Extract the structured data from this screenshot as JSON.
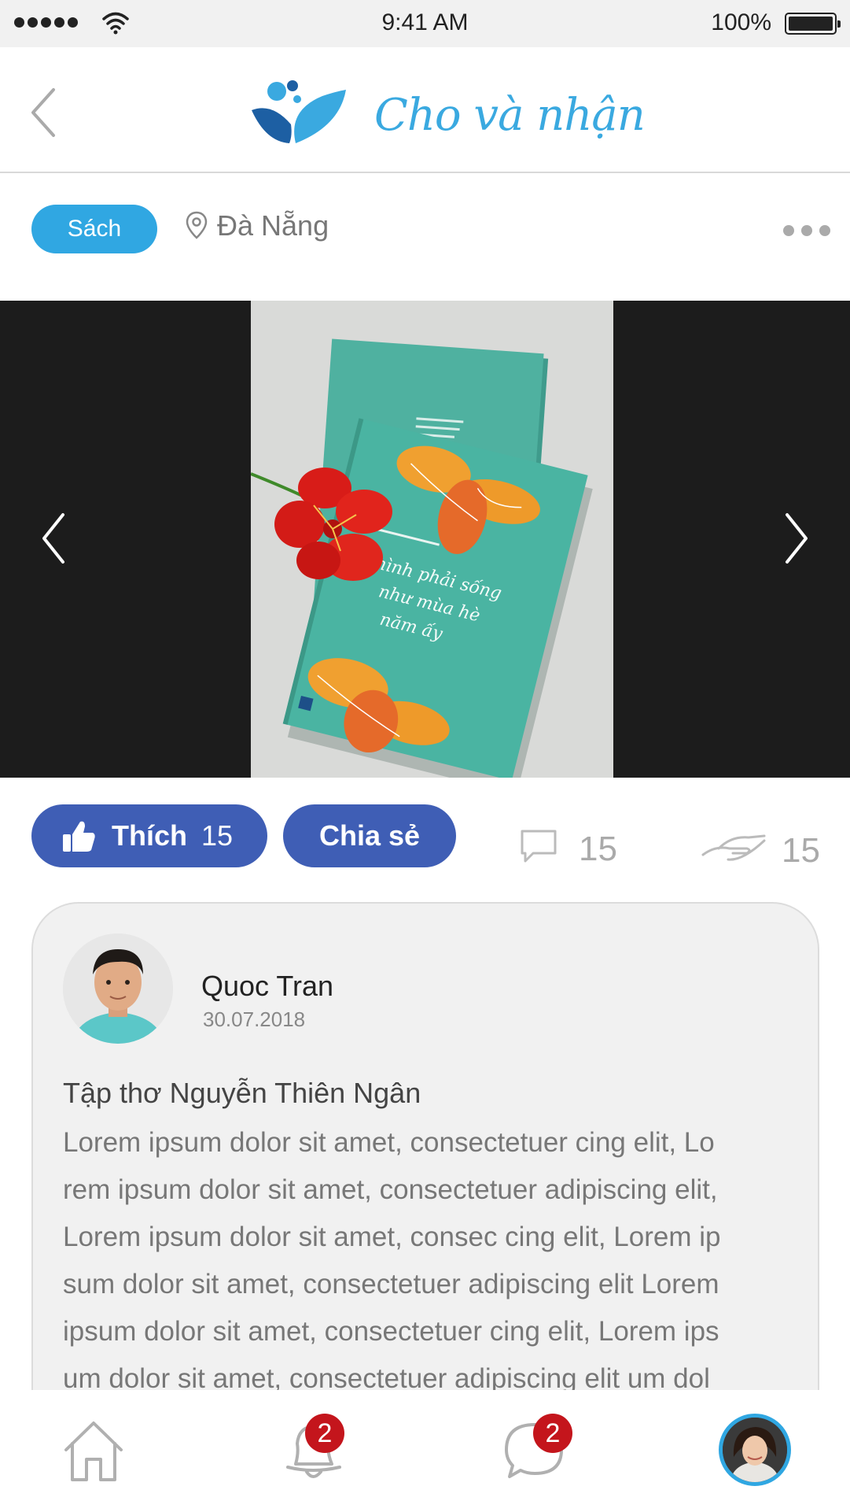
{
  "status_bar": {
    "time": "9:41 AM",
    "battery": "100%"
  },
  "header": {
    "title": "Cho và nhận"
  },
  "post_meta": {
    "category": "Sách",
    "location": "Đà Nẵng"
  },
  "actions": {
    "like_label": "Thích",
    "like_count": "15",
    "share_label": "Chia sẻ",
    "comment_count": "15",
    "give_count": "15"
  },
  "post": {
    "author": "Quoc Tran",
    "date": "30.07.2018",
    "title": "Tập thơ Nguyễn Thiên Ngân",
    "body_lines": [
      "Lorem ipsum dolor sit amet, consectetuer  cing elit, Lo",
      "rem ipsum dolor sit amet, consectetuer adipiscing elit,",
      "Lorem ipsum dolor sit amet, consec cing elit, Lorem ip",
      "sum dolor sit amet, consectetuer adipiscing elit Lorem",
      "ipsum dolor sit amet, consectetuer cing elit, Lorem ips",
      "um dolor sit amet, consectetuer adipiscing elit um dol"
    ]
  },
  "book_cover_text": [
    "mình phải sống",
    "như mùa hè",
    "năm ấy"
  ],
  "bottom_nav": {
    "notifications_badge": "2",
    "messages_badge": "2"
  },
  "colors": {
    "brand_blue": "#30a7e2",
    "action_blue": "#3f5eb5",
    "badge_red": "#c4151c"
  }
}
